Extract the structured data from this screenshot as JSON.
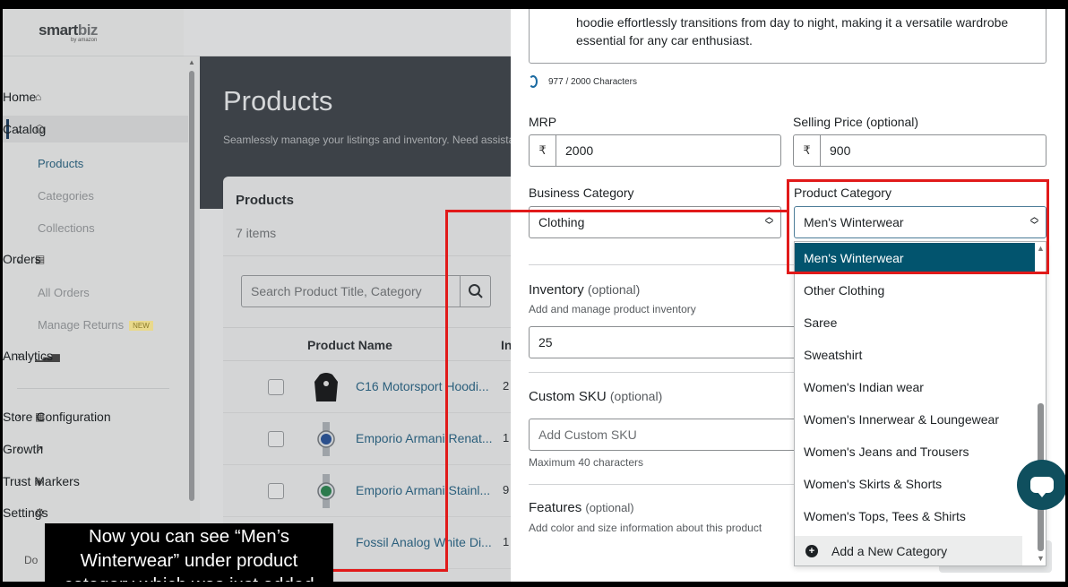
{
  "brand": {
    "logo_main": "smart",
    "logo_accent": "biz",
    "logo_sub": "by amazon"
  },
  "sidebar": {
    "home": "Home",
    "catalog": "Catalog",
    "catalog_items": [
      "Products",
      "Categories",
      "Collections"
    ],
    "orders": "Orders",
    "orders_items": [
      "All Orders",
      "Manage Returns"
    ],
    "new_badge": "NEW",
    "analytics": "Analytics",
    "store_configuration": "Store Configuration",
    "growth": "Growth",
    "trust_markers": "Trust Markers",
    "settings": "Settings",
    "footer_partial": "Do"
  },
  "main": {
    "title": "Products",
    "subtitle": "Seamlessly manage your listings and inventory. Need assista",
    "card_title": "Products",
    "item_count": "7 items",
    "search_placeholder": "Search Product Title, Category",
    "col_product_name": "Product Name",
    "col_inventory": "In",
    "products": [
      {
        "title": "C16 Motorsport Hoodi...",
        "inv": "2"
      },
      {
        "title": "Emporio Armani Renat...",
        "inv": "1"
      },
      {
        "title": "Emporio Armani Stainl...",
        "inv": "9"
      },
      {
        "title": "Fossil Analog White Di...",
        "inv": "1"
      }
    ]
  },
  "panel": {
    "description_line1": "hoodie effortlessly transitions from day to night, making it a versatile wardrobe",
    "description_line2": "essential for any car enthusiast.",
    "char_count": "977 / 2000 Characters",
    "mrp_label": "MRP",
    "currency": "₹",
    "mrp_value": "2000",
    "selling_label": "Selling Price",
    "optional": "(optional)",
    "selling_value": "900",
    "business_category_label": "Business Category",
    "business_category_value": "Clothing",
    "product_category_label": "Product Category",
    "product_category_value": "Men's Winterwear",
    "inventory_label": "Inventory",
    "inventory_hint": "Add and manage product inventory",
    "inventory_value": "25",
    "sku_label": "Custom SKU",
    "sku_placeholder": "Add Custom SKU",
    "sku_hint": "Maximum 40 characters",
    "features_label": "Features",
    "features_hint": "Add color and size information about this product"
  },
  "dropdown": {
    "options": [
      "Men's Winterwear",
      "Other Clothing",
      "Saree",
      "Sweatshirt",
      "Women's Indian wear",
      "Women's Innerwear & Loungewear",
      "Women's Jeans and Trousers",
      "Women's Skirts & Shorts",
      "Women's Tops, Tees & Shirts"
    ],
    "selected": "Men's Winterwear",
    "add_new": "Add a New Category"
  },
  "callout": {
    "line1": "Now you can see “Men’s",
    "line2": "Winterwear” under product",
    "line3": "category which was just added"
  },
  "colors": {
    "accent": "#02546e",
    "annotation": "#e11a1a",
    "link": "#2b5f7c"
  }
}
